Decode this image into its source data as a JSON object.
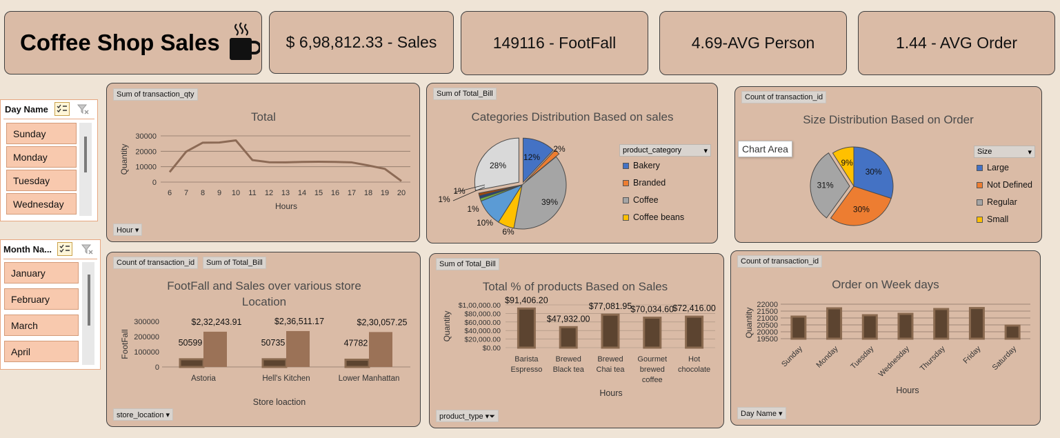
{
  "header": {
    "title": "Coffee Shop Sales",
    "kpis": [
      "$ 6,98,812.33 - Sales",
      "149116 - FootFall",
      "4.69-AVG Person",
      "1.44 - AVG Order"
    ]
  },
  "slicers": {
    "day": {
      "label": "Day Name",
      "items": [
        "Sunday",
        "Monday",
        "Tuesday",
        "Wednesday"
      ]
    },
    "month": {
      "label": "Month Na...",
      "items": [
        "January",
        "February",
        "March",
        "April"
      ]
    }
  },
  "fields": {
    "c1_value": "Sum of transaction_qty",
    "c1_axis": "Hour",
    "c2_value": "Sum of Total_Bill",
    "c2_legend": "product_category",
    "c3_value": "Count of transaction_id",
    "c3_legend": "Size",
    "c4_value1": "Count of transaction_id",
    "c4_value2": "Sum of Total_Bill",
    "c4_axis": "store_location",
    "c5_value": "Sum of Total_Bill",
    "c5_axis": "product_type",
    "c6_value": "Count of transaction_id",
    "c6_axis": "Day Name"
  },
  "tooltip": "Chart Area",
  "colors": {
    "line": "#8c6a55",
    "bar_dark": "#5c4430",
    "bar_light": "#9b7257",
    "blue": "#4472c4",
    "orange": "#ed7d31",
    "gray": "#a5a5a5",
    "yellow": "#ffc000"
  },
  "chart_data": [
    {
      "id": "hourly",
      "type": "line",
      "title": "Total",
      "xlabel": "Hours",
      "ylabel": "Quantity",
      "x": [
        6,
        7,
        8,
        9,
        10,
        11,
        12,
        13,
        14,
        15,
        16,
        17,
        18,
        19,
        20
      ],
      "y": [
        6500,
        19800,
        25600,
        25700,
        27100,
        14300,
        12900,
        12800,
        13100,
        13200,
        13100,
        12800,
        10800,
        8600,
        700
      ],
      "ylim": [
        0,
        30000
      ],
      "yticks": [
        0,
        10000,
        20000,
        30000
      ]
    },
    {
      "id": "categories",
      "type": "pie",
      "title": "Categories Distribution Based on sales",
      "legend_title": "product_category",
      "legend": [
        "Bakery",
        "Branded",
        "Coffee",
        "Coffee beans"
      ],
      "slices": [
        {
          "label": "12%",
          "value": 12,
          "color": "#4472c4"
        },
        {
          "label": "2%",
          "value": 2,
          "color": "#ed7d31"
        },
        {
          "label": "39%",
          "value": 39,
          "color": "#a5a5a5"
        },
        {
          "label": "6%",
          "value": 6,
          "color": "#ffc000"
        },
        {
          "label": "10%",
          "value": 10,
          "color": "#5b9bd5"
        },
        {
          "label": "1%",
          "value": 1,
          "color": "#70ad47"
        },
        {
          "label": "1%",
          "value": 1,
          "color": "#264478"
        },
        {
          "label": "1%",
          "value": 1,
          "color": "#9e480e"
        },
        {
          "label": "28%",
          "value": 28,
          "color": "#d9d9d9"
        }
      ]
    },
    {
      "id": "size",
      "type": "pie",
      "title": "Size Distribution Based on Order",
      "legend_title": "Size",
      "legend": [
        "Large",
        "Not Defined",
        "Regular",
        "Small"
      ],
      "slices": [
        {
          "label": "30%",
          "value": 30,
          "color": "#4472c4"
        },
        {
          "label": "30%",
          "value": 30,
          "color": "#ed7d31"
        },
        {
          "label": "31%",
          "value": 31,
          "color": "#a5a5a5"
        },
        {
          "label": "9%",
          "value": 9,
          "color": "#ffc000"
        }
      ]
    },
    {
      "id": "stores",
      "type": "bar",
      "title": "FootFall and Sales  over various store Location",
      "xlabel": "Store loaction",
      "ylabel": "FootFall",
      "categories": [
        "Astoria",
        "Hell's Kitchen",
        "Lower Manhattan"
      ],
      "series": [
        {
          "name": "Count of transaction_id",
          "values": [
            50599,
            50735,
            47782
          ],
          "labels": [
            "50599",
            "50735",
            "47782"
          ]
        },
        {
          "name": "Sum of Total_Bill",
          "values": [
            232243.91,
            236511.17,
            230057.25
          ],
          "labels": [
            "$2,32,243.91",
            "$2,36,511.17",
            "$2,30,057.25"
          ]
        }
      ],
      "ylim": [
        0,
        300000
      ],
      "yticks": [
        "0",
        "100000",
        "200000",
        "300000"
      ]
    },
    {
      "id": "products",
      "type": "bar",
      "title": "Total % of products Based on Sales",
      "xlabel": "Hours",
      "ylabel": "Quantity",
      "categories": [
        [
          "Barista",
          "Espresso"
        ],
        [
          "Brewed",
          "Black tea"
        ],
        [
          "Brewed",
          "Chai tea"
        ],
        [
          "Gourmet",
          "brewed",
          "coffee"
        ],
        [
          "Hot",
          "chocolate"
        ]
      ],
      "values": [
        91406.2,
        47932.0,
        77081.95,
        70034.6,
        72416.0
      ],
      "labels": [
        "$91,406.20",
        "$47,932.00",
        "$77,081.95",
        "$70,034.60",
        "$72,416.00"
      ],
      "ylim": [
        0,
        100000
      ],
      "yticks": [
        "$0.00",
        "$20,000.00",
        "$40,000.00",
        "$60,000.00",
        "$80,000.00",
        "$1,00,000.00"
      ]
    },
    {
      "id": "weekdays",
      "type": "bar",
      "title": "Order on Week days",
      "xlabel": "Hours",
      "ylabel": "Quantity",
      "categories": [
        "Sunday",
        "Monday",
        "Tuesday",
        "Wednesday",
        "Thursday",
        "Friday",
        "Saturday"
      ],
      "values": [
        21100,
        21700,
        21200,
        21300,
        21650,
        21720,
        20450
      ],
      "ylim": [
        19500,
        22000
      ],
      "yticks": [
        "19500",
        "20000",
        "20500",
        "21000",
        "21500",
        "22000"
      ]
    }
  ]
}
